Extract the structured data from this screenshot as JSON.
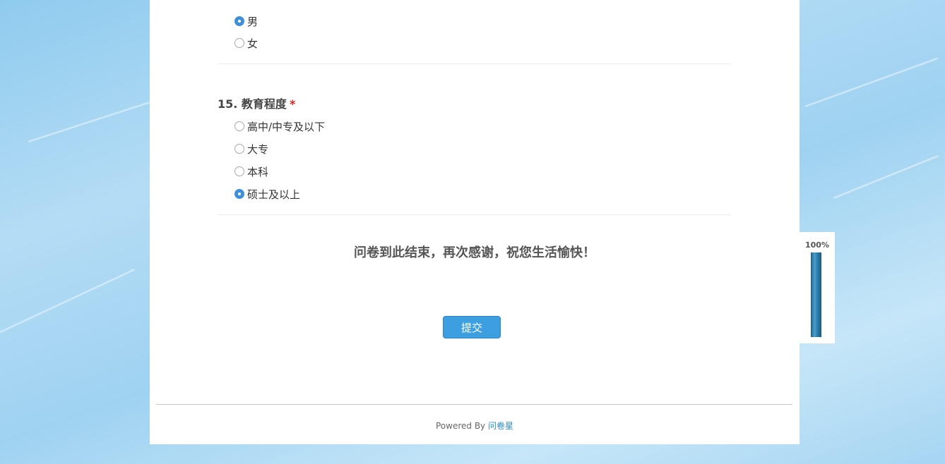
{
  "question14": {
    "options": [
      {
        "label": "男",
        "checked": true
      },
      {
        "label": "女",
        "checked": false
      }
    ]
  },
  "question15": {
    "number": "15.",
    "title": "教育程度",
    "required_mark": "*",
    "options": [
      {
        "label": "高中/中专及以下",
        "checked": false
      },
      {
        "label": "大专",
        "checked": false
      },
      {
        "label": "本科",
        "checked": false
      },
      {
        "label": "硕士及以上",
        "checked": true
      }
    ]
  },
  "end_message": "问卷到此结束，再次感谢，祝您生活愉快！",
  "submit_label": "提交",
  "footer": {
    "powered_by": "Powered By",
    "brand": "问卷星"
  },
  "progress": {
    "label": "100%",
    "value": 1.0
  },
  "colors": {
    "accent": "#3d9fe0",
    "required": "#e02020",
    "link": "#2a8fd6"
  }
}
